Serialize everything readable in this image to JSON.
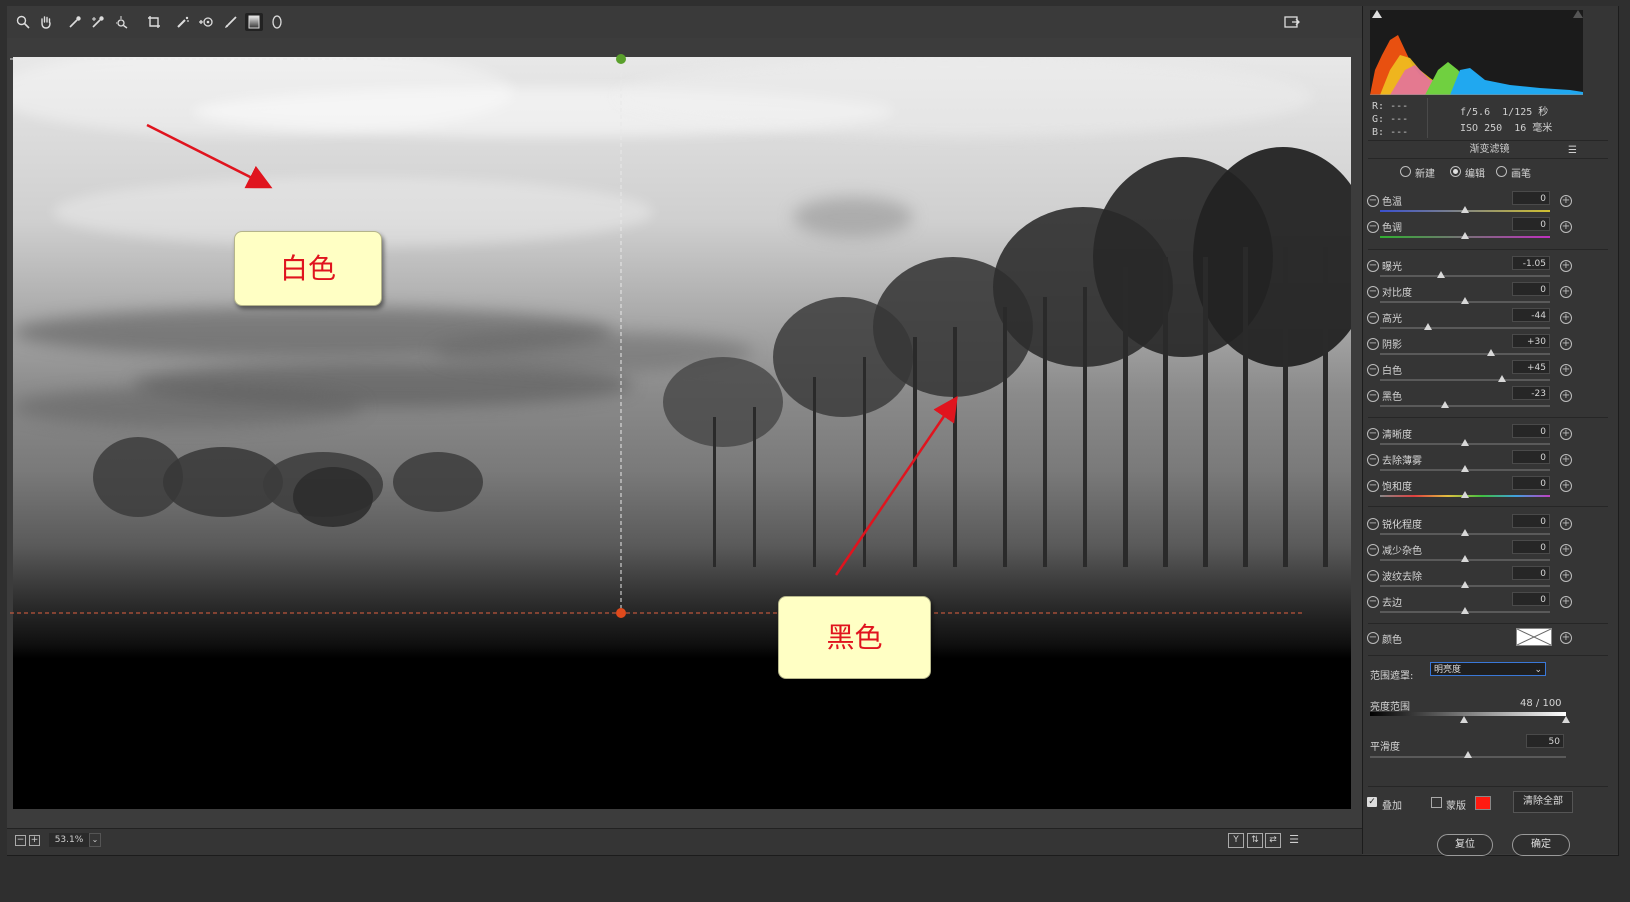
{
  "toolbar": {
    "tools": [
      "zoom-icon",
      "hand-icon",
      "white-balance-icon",
      "color-sampler-icon",
      "targeted-adjustment-icon",
      "crop-icon",
      "spot-removal-icon",
      "red-eye-icon",
      "adjustment-brush-icon",
      "graduated-filter-icon",
      "radial-filter-icon"
    ],
    "open_preferences_icon": "fullscreen-toggle-icon"
  },
  "annotations": {
    "white_callout": "白色",
    "black_callout": "黑色",
    "arrow_color": "#e0141e"
  },
  "statusbar": {
    "zoom": "53.1%",
    "view_buttons": [
      "Y",
      "before-after-icon",
      "swap-icon",
      "settings-icon"
    ]
  },
  "histogram": {
    "rgb": {
      "r_label": "R:",
      "r_val": "---",
      "g_label": "G:",
      "g_val": "---",
      "b_label": "B:",
      "b_val": "---"
    },
    "exif": {
      "aperture": "f/5.6",
      "shutter": "1/125 秒",
      "iso": "ISO 250",
      "focal": "16 毫米"
    }
  },
  "panel": {
    "title": "渐变滤镜",
    "modes": [
      {
        "label": "新建",
        "selected": false
      },
      {
        "label": "编辑",
        "selected": true
      },
      {
        "label": "画笔",
        "selected": false
      }
    ],
    "sliders": [
      {
        "label": "色温",
        "value": "0",
        "pos": 0.5,
        "track": "temp"
      },
      {
        "label": "色调",
        "value": "0",
        "pos": 0.5,
        "track": "tint"
      },
      {
        "label": "曝光",
        "value": "-1.05",
        "pos": 0.36,
        "track": "plain"
      },
      {
        "label": "对比度",
        "value": "0",
        "pos": 0.5,
        "track": "plain"
      },
      {
        "label": "高光",
        "value": "-44",
        "pos": 0.28,
        "track": "plain"
      },
      {
        "label": "阴影",
        "value": "+30",
        "pos": 0.65,
        "track": "plain"
      },
      {
        "label": "白色",
        "value": "+45",
        "pos": 0.72,
        "track": "plain"
      },
      {
        "label": "黑色",
        "value": "-23",
        "pos": 0.38,
        "track": "plain"
      },
      {
        "label": "清晰度",
        "value": "0",
        "pos": 0.5,
        "track": "plain"
      },
      {
        "label": "去除薄雾",
        "value": "0",
        "pos": 0.5,
        "track": "plain"
      },
      {
        "label": "饱和度",
        "value": "0",
        "pos": 0.5,
        "track": "sat"
      },
      {
        "label": "锐化程度",
        "value": "0",
        "pos": 0.5,
        "track": "plain"
      },
      {
        "label": "减少杂色",
        "value": "0",
        "pos": 0.5,
        "track": "plain"
      },
      {
        "label": "波纹去除",
        "value": "0",
        "pos": 0.5,
        "track": "plain"
      },
      {
        "label": "去边",
        "value": "0",
        "pos": 0.5,
        "track": "plain"
      }
    ],
    "color_label": "颜色",
    "range_mask_label": "范围遮罩:",
    "range_mask_value": "明亮度",
    "luminance_range_label": "亮度范围",
    "luminance_range_value": "48 / 100",
    "luminance_range_low": 0.48,
    "luminance_range_high": 1.0,
    "smoothness_label": "平滑度",
    "smoothness_value": "50",
    "smoothness_pos": 0.5,
    "overlay_label": "叠加",
    "overlay_checked": true,
    "mask_label": "蒙版",
    "mask_checked": false,
    "mask_color": "#ff1a10",
    "clear_all": "清除全部"
  },
  "dialog": {
    "reset": "复位",
    "ok": "确定"
  }
}
